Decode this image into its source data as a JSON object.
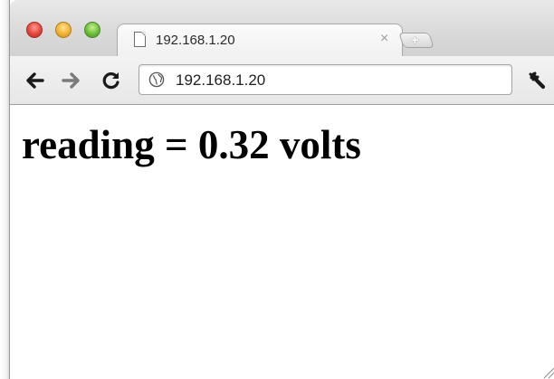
{
  "window": {
    "controls": [
      {
        "name": "close-window-button",
        "color": "#e2453a"
      },
      {
        "name": "minimize-window-button",
        "color": "#f2b134"
      },
      {
        "name": "zoom-window-button",
        "color": "#6cbd3c"
      }
    ]
  },
  "tabs": [
    {
      "title": "192.168.1.20",
      "icon": "page-icon",
      "close_label": "×",
      "active": true
    }
  ],
  "new_tab": {
    "label": "+"
  },
  "toolbar": {
    "back_icon": "back-arrow-icon",
    "forward_icon": "forward-arrow-icon",
    "reload_icon": "reload-icon",
    "menu_icon": "wrench-icon"
  },
  "omnibox": {
    "icon": "globe-icon",
    "url": "192.168.1.20"
  },
  "page": {
    "heading": "reading = 0.32 volts"
  }
}
